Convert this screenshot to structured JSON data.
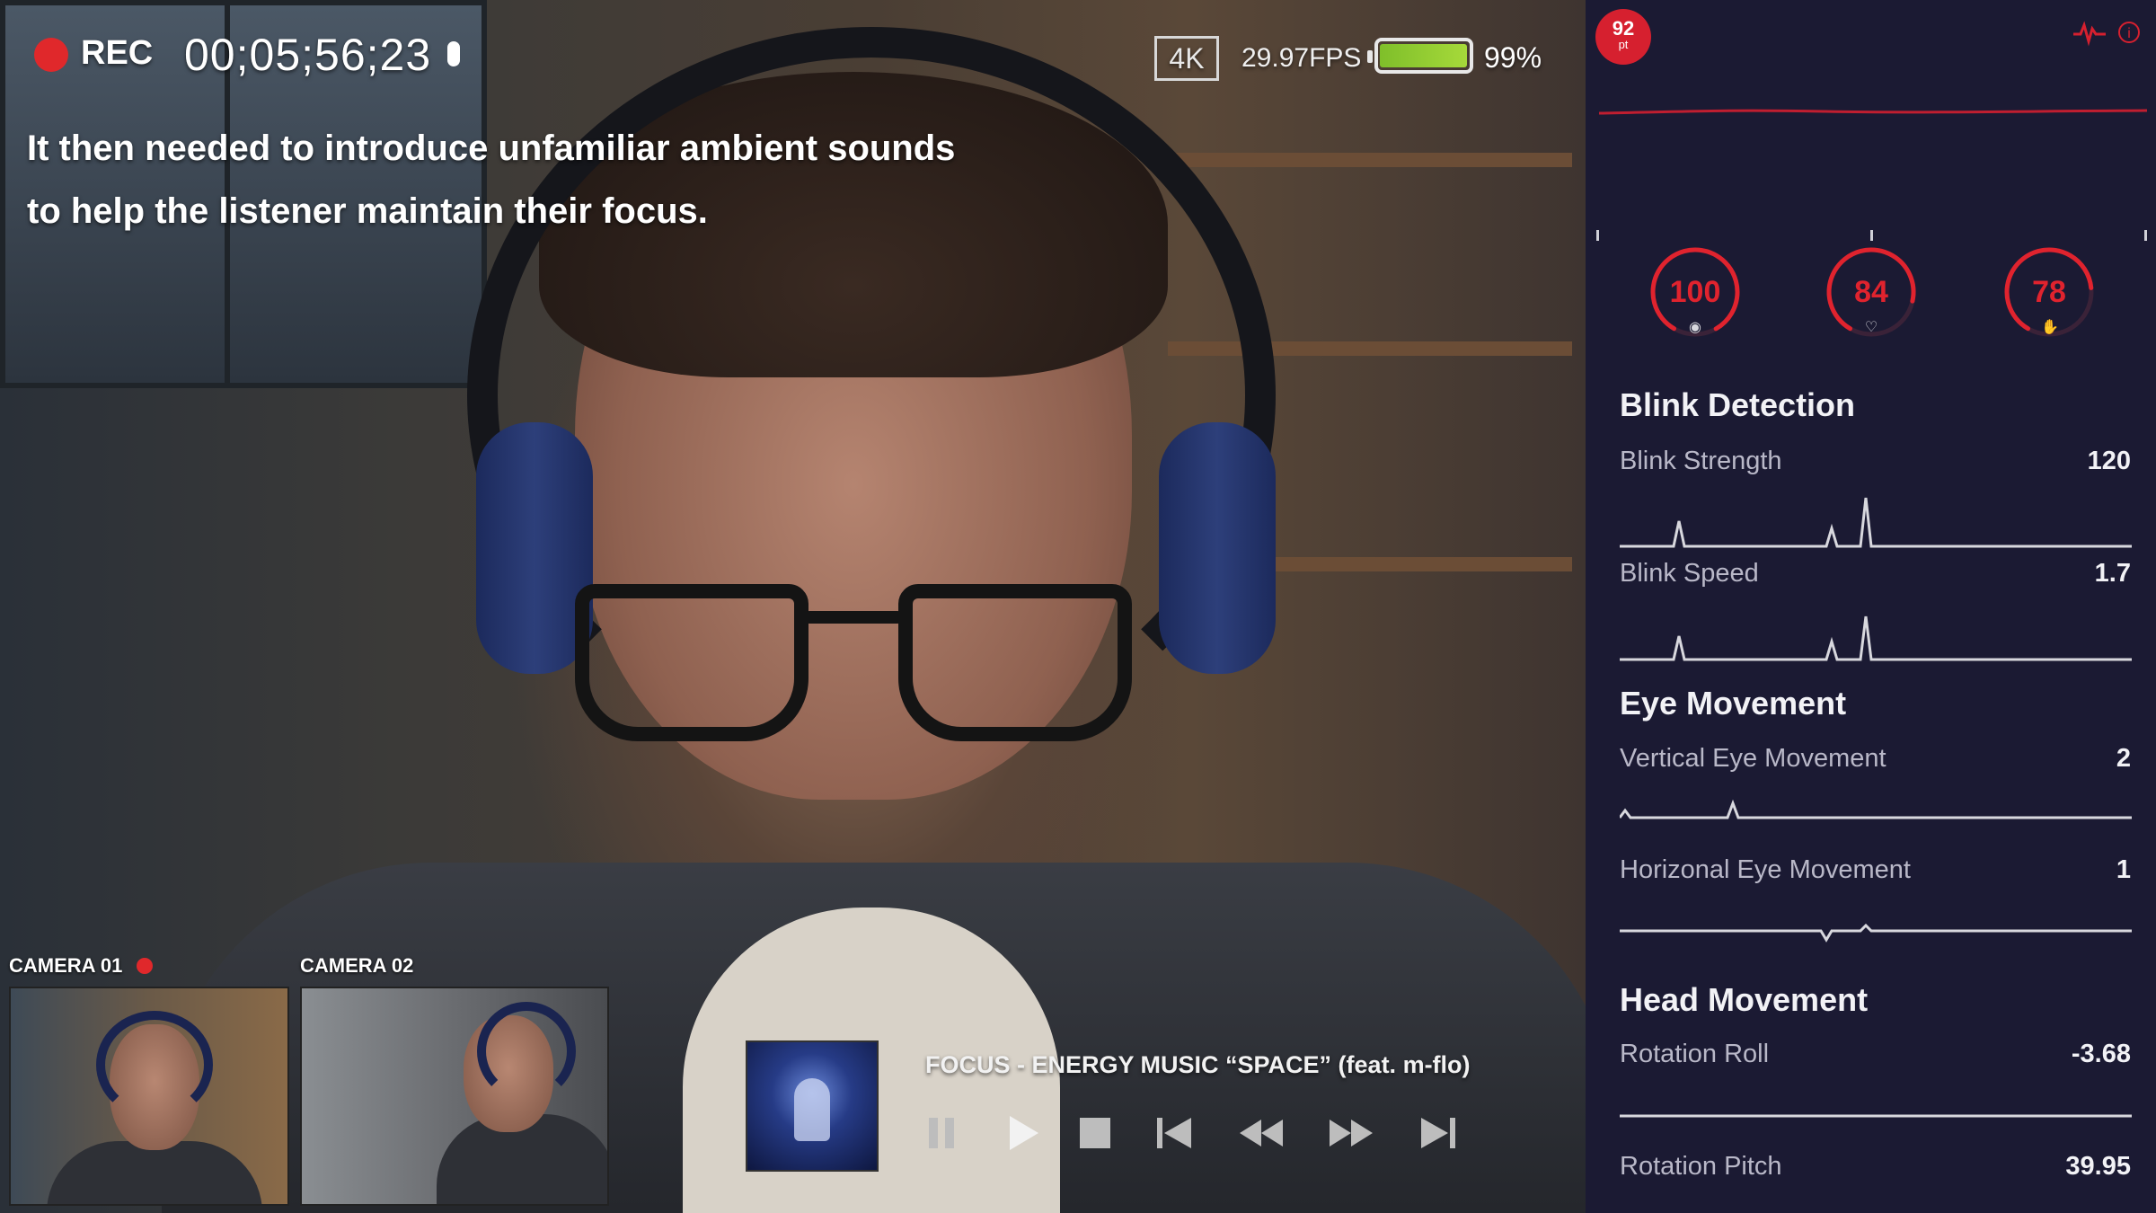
{
  "recording": {
    "label": "REC",
    "timecode": "00;05;56;23"
  },
  "camera_status": {
    "resolution": "4K",
    "fps": "29.97FPS",
    "battery_pct": "99%",
    "battery_level": 0.99
  },
  "subtitle": {
    "line1": "It then needed to introduce unfamiliar ambient sounds",
    "line2": "to help the listener maintain their focus."
  },
  "cameras": [
    {
      "label": "CAMERA 01",
      "active": true
    },
    {
      "label": "CAMERA 02",
      "active": false
    }
  ],
  "player": {
    "track": "FOCUS - ENERGY MUSIC “SPACE” (feat. m-flo)",
    "controls": [
      "pause",
      "play",
      "stop",
      "skip-back",
      "rewind",
      "fast-forward",
      "skip-forward"
    ]
  },
  "panel": {
    "score": {
      "value": "92",
      "unit": "pt"
    },
    "gauges": [
      {
        "value": "100",
        "icon": "brain-icon",
        "level": 1.0
      },
      {
        "value": "84",
        "icon": "heart-icon",
        "level": 0.84
      },
      {
        "value": "78",
        "icon": "hand-icon",
        "level": 0.78
      }
    ],
    "sections": {
      "blink": {
        "title": "Blink Detection",
        "metrics": [
          {
            "label": "Blink Strength",
            "value": "120"
          },
          {
            "label": "Blink Speed",
            "value": "1.7"
          }
        ]
      },
      "eye": {
        "title": "Eye Movement",
        "metrics": [
          {
            "label": "Vertical Eye Movement",
            "value": "2"
          },
          {
            "label": "Horizonal Eye Movement",
            "value": "1"
          }
        ]
      },
      "head": {
        "title": "Head Movement",
        "metrics": [
          {
            "label": "Rotation Roll",
            "value": "-3.68"
          },
          {
            "label": "Rotation Pitch",
            "value": "39.95"
          }
        ]
      }
    }
  },
  "colors": {
    "accent": "#e0232e",
    "panel_bg": "#1b1a33",
    "battery": "#9ad236"
  }
}
